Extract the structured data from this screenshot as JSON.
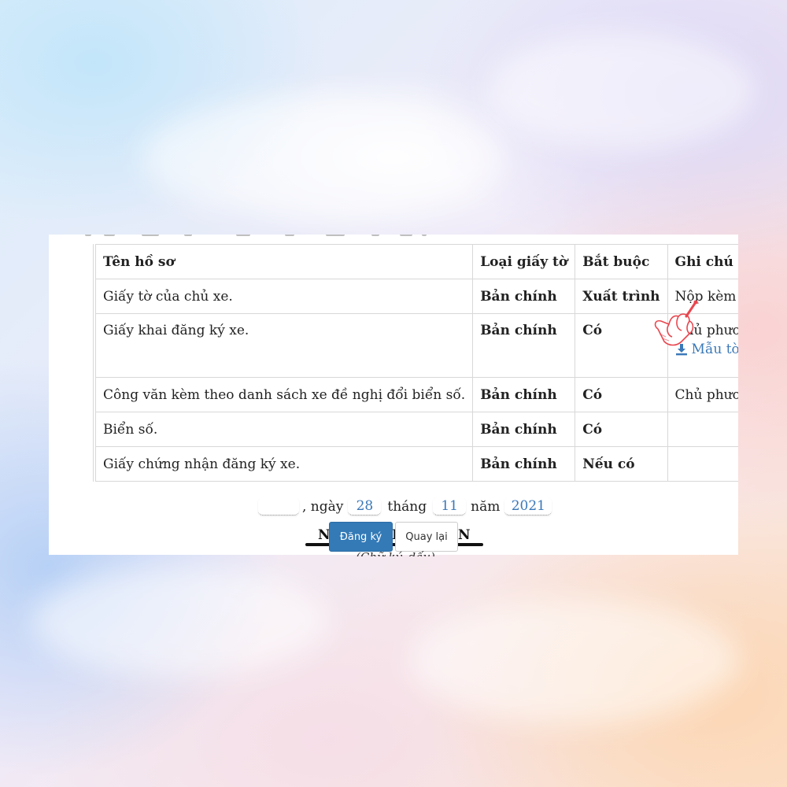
{
  "table": {
    "headers": [
      "Tên hồ sơ",
      "Loại giấy tờ",
      "Bắt buộc",
      "Ghi chú"
    ],
    "rows": [
      {
        "name": "Giấy tờ của chủ xe.",
        "type": "Bản chính",
        "required": "Xuất trình",
        "note": "Nộp kèm theo G"
      },
      {
        "name": "Giấy khai đăng ký xe.",
        "type": "Bản chính",
        "required": "Có",
        "note": "Chủ phương tiện",
        "link": "Mẫu tờ khai"
      },
      {
        "name": "Công văn kèm theo danh sách xe đề nghị đổi biển số.",
        "type": "Bản chính",
        "required": "Có",
        "note": "Chủ phương tiện"
      },
      {
        "name": "Biển số.",
        "type": "Bản chính",
        "required": "Có",
        "note": ""
      },
      {
        "name": "Giấy chứng nhận đăng ký xe.",
        "type": "Bản chính",
        "required": "Nếu có",
        "note": ""
      }
    ]
  },
  "date": {
    "place": "",
    "sep_ngay": ", ngày",
    "day": "28",
    "label_thang": "tháng",
    "month": "11",
    "label_nam": "năm",
    "year": "2021"
  },
  "signature": {
    "left_letter": "N",
    "mid_letter": "I",
    "right_letter": "N",
    "note": "(Chữ ký, dấu)"
  },
  "buttons": {
    "register": "Đăng ký",
    "back": "Quay lại"
  },
  "colors": {
    "primary": "#337ab7",
    "link": "#3a78b8",
    "hand_accent": "#e8474f"
  }
}
